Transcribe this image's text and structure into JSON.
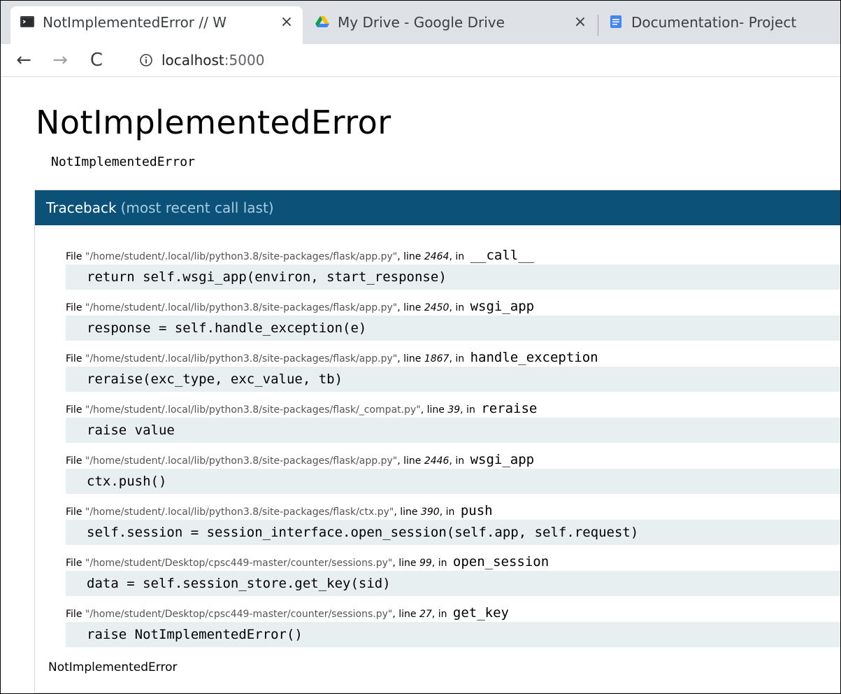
{
  "browser": {
    "tabs": [
      {
        "title": "NotImplementedError // W",
        "icon": "terminal-icon",
        "active": true,
        "close": "×"
      },
      {
        "title": "My Drive - Google Drive",
        "icon": "google-drive-icon",
        "active": false,
        "close": "×"
      },
      {
        "title": "Documentation- Project",
        "icon": "google-docs-icon",
        "active": false
      }
    ],
    "nav": {
      "back": "←",
      "forward": "→",
      "reload": "C"
    },
    "address": {
      "host": "localhost",
      "port": ":5000"
    }
  },
  "page": {
    "title": "NotImplementedError",
    "message": "NotImplementedError",
    "traceback": {
      "heading": "Traceback",
      "subheading": "(most recent call last)",
      "frames": [
        {
          "file": "\"/home/student/.local/lib/python3.8/site-packages/flask/app.py\"",
          "line": "2464",
          "func": "__call__",
          "code": "return self.wsgi_app(environ, start_response)"
        },
        {
          "file": "\"/home/student/.local/lib/python3.8/site-packages/flask/app.py\"",
          "line": "2450",
          "func": "wsgi_app",
          "code": "response = self.handle_exception(e)"
        },
        {
          "file": "\"/home/student/.local/lib/python3.8/site-packages/flask/app.py\"",
          "line": "1867",
          "func": "handle_exception",
          "code": "reraise(exc_type, exc_value, tb)"
        },
        {
          "file": "\"/home/student/.local/lib/python3.8/site-packages/flask/_compat.py\"",
          "line": "39",
          "func": "reraise",
          "code": "raise value"
        },
        {
          "file": "\"/home/student/.local/lib/python3.8/site-packages/flask/app.py\"",
          "line": "2446",
          "func": "wsgi_app",
          "code": "ctx.push()"
        },
        {
          "file": "\"/home/student/.local/lib/python3.8/site-packages/flask/ctx.py\"",
          "line": "390",
          "func": "push",
          "code": "self.session = session_interface.open_session(self.app, self.request)"
        },
        {
          "file": "\"/home/student/Desktop/cpsc449-master/counter/sessions.py\"",
          "line": "99",
          "func": "open_session",
          "code": "data = self.session_store.get_key(sid)"
        },
        {
          "file": "\"/home/student/Desktop/cpsc449-master/counter/sessions.py\"",
          "line": "27",
          "func": "get_key",
          "code": "raise NotImplementedError()"
        }
      ],
      "labels": {
        "file": "File ",
        "line": ", line ",
        "in": ", in "
      },
      "final": "NotImplementedError"
    }
  },
  "colors": {
    "traceback_header": "#0c5178",
    "traceback_sub": "#a7cde5",
    "code_bg": "#e8eff0"
  }
}
